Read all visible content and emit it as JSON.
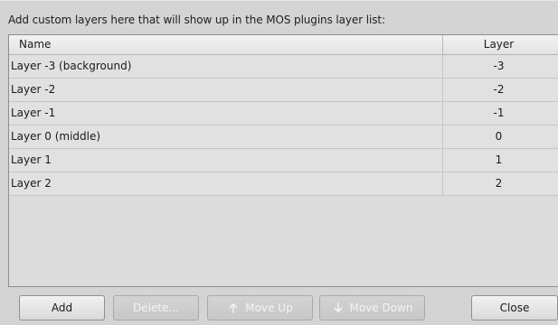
{
  "instruction": "Add custom layers here that will show up in the MOS plugins layer list:",
  "table": {
    "columns": [
      "Name",
      "Layer"
    ],
    "rows": [
      {
        "name": "Layer -3 (background)",
        "layer": "-3"
      },
      {
        "name": "Layer -2",
        "layer": "-2"
      },
      {
        "name": "Layer -1",
        "layer": "-1"
      },
      {
        "name": "Layer 0 (middle)",
        "layer": "0"
      },
      {
        "name": "Layer 1",
        "layer": "1"
      },
      {
        "name": "Layer 2",
        "layer": "2"
      }
    ]
  },
  "buttons": {
    "add": "Add",
    "delete": "Delete...",
    "move_up": "Move Up",
    "move_down": "Move Down",
    "close": "Close"
  },
  "icons": {
    "move_up": "arrow-up-icon",
    "move_down": "arrow-down-icon"
  },
  "colors": {
    "disabled_text": "#f4f4f4",
    "background": "#d4d4d4"
  }
}
